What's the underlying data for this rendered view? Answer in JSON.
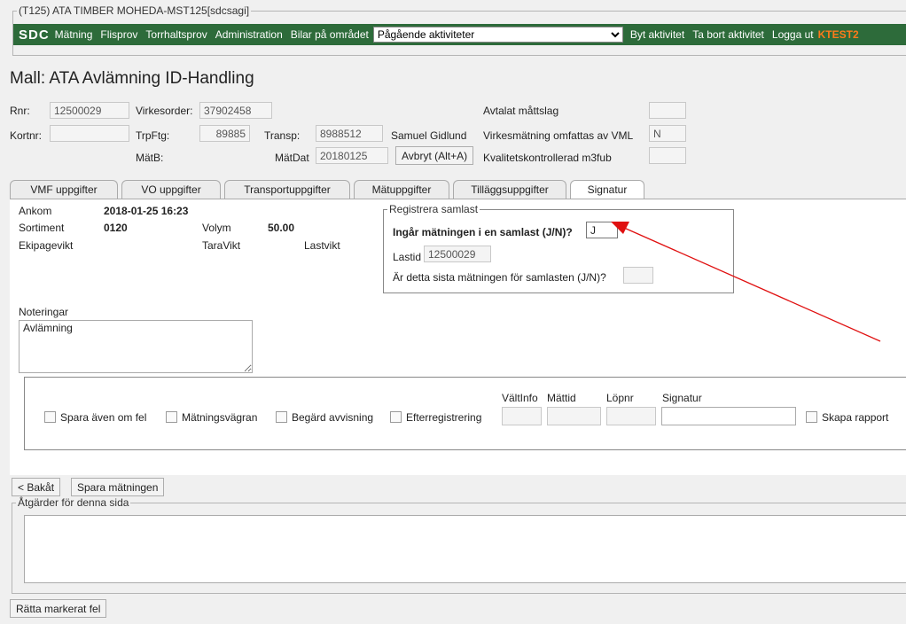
{
  "window": {
    "title": "(T125) ATA TIMBER MOHEDA-MST125[sdcsagi]"
  },
  "nav": {
    "logo": "SDC",
    "items": [
      "Mätning",
      "Flisprov",
      "Torrhaltsprov",
      "Administration",
      "Bilar på området"
    ],
    "activity_select": "Pågående aktiviteter",
    "actions": [
      "Byt aktivitet",
      "Ta bort aktivitet",
      "Logga ut"
    ],
    "env": "KTEST2"
  },
  "page": {
    "title": "Mall: ATA Avlämning ID-Handling"
  },
  "header": {
    "rnr_label": "Rnr:",
    "rnr": "12500029",
    "virkesorder_label": "Virkesorder:",
    "virkesorder": "37902458",
    "kortnr_label": "Kortnr:",
    "kortnr": "",
    "trpftg_label": "TrpFtg:",
    "trpftg": "89885",
    "transp_label": "Transp:",
    "transp": "8988512",
    "transp_name": "Samuel Gidlund",
    "matb_label": "MätB:",
    "matdat_label": "MätDat",
    "matdat": "20180125",
    "cancel_button": "Avbryt (Alt+A)",
    "avtalat_label": "Avtalat måttslag",
    "avtalat": "",
    "vml_label": "Virkesmätning omfattas av VML",
    "vml": "N",
    "kvalitet_label": "Kvalitetskontrollerad m3fub",
    "kvalitet": ""
  },
  "tabs": [
    "VMF uppgifter",
    "VO uppgifter",
    "Transportuppgifter",
    "Mätuppgifter",
    "Tilläggsuppgifter",
    "Signatur"
  ],
  "signatur": {
    "ankom_label": "Ankom",
    "ankom": "2018-01-25 16:23",
    "sortiment_label": "Sortiment",
    "sortiment": "0120",
    "volym_label": "Volym",
    "volym": "50.00",
    "ekipagevikt_label": "Ekipagevikt",
    "taravikt_label": "TaraVikt",
    "lastvikt_label": "Lastvikt",
    "samlast": {
      "legend": "Registrera samlast",
      "q1": "Ingår mätningen i en samlast (J/N)?",
      "q1_value": "J",
      "lastid_label": "Lastid",
      "lastid": "12500029",
      "q2": "Är detta sista mätningen för samlasten (J/N)?",
      "q2_value": ""
    },
    "noteringar_label": "Noteringar",
    "noteringar": "Avlämning",
    "checkboxes": [
      "Spara även om fel",
      "Mätningsvägran",
      "Begärd avvisning",
      "Efterregistrering"
    ],
    "valtinfo_label": "VältInfo",
    "mattid_label": "Mättid",
    "lopnr_label": "Löpnr",
    "signatur_label": "Signatur",
    "skapa_rapport": "Skapa rapport"
  },
  "footer": {
    "back_button": "< Bakåt",
    "save_button": "Spara mätningen",
    "actions_legend": "Åtgärder för denna sida",
    "fix_button": "Rätta markerat fel"
  },
  "colors": {
    "navbar": "#2d6b3a",
    "env": "#ff7a1a",
    "arrow": "#e01010"
  }
}
